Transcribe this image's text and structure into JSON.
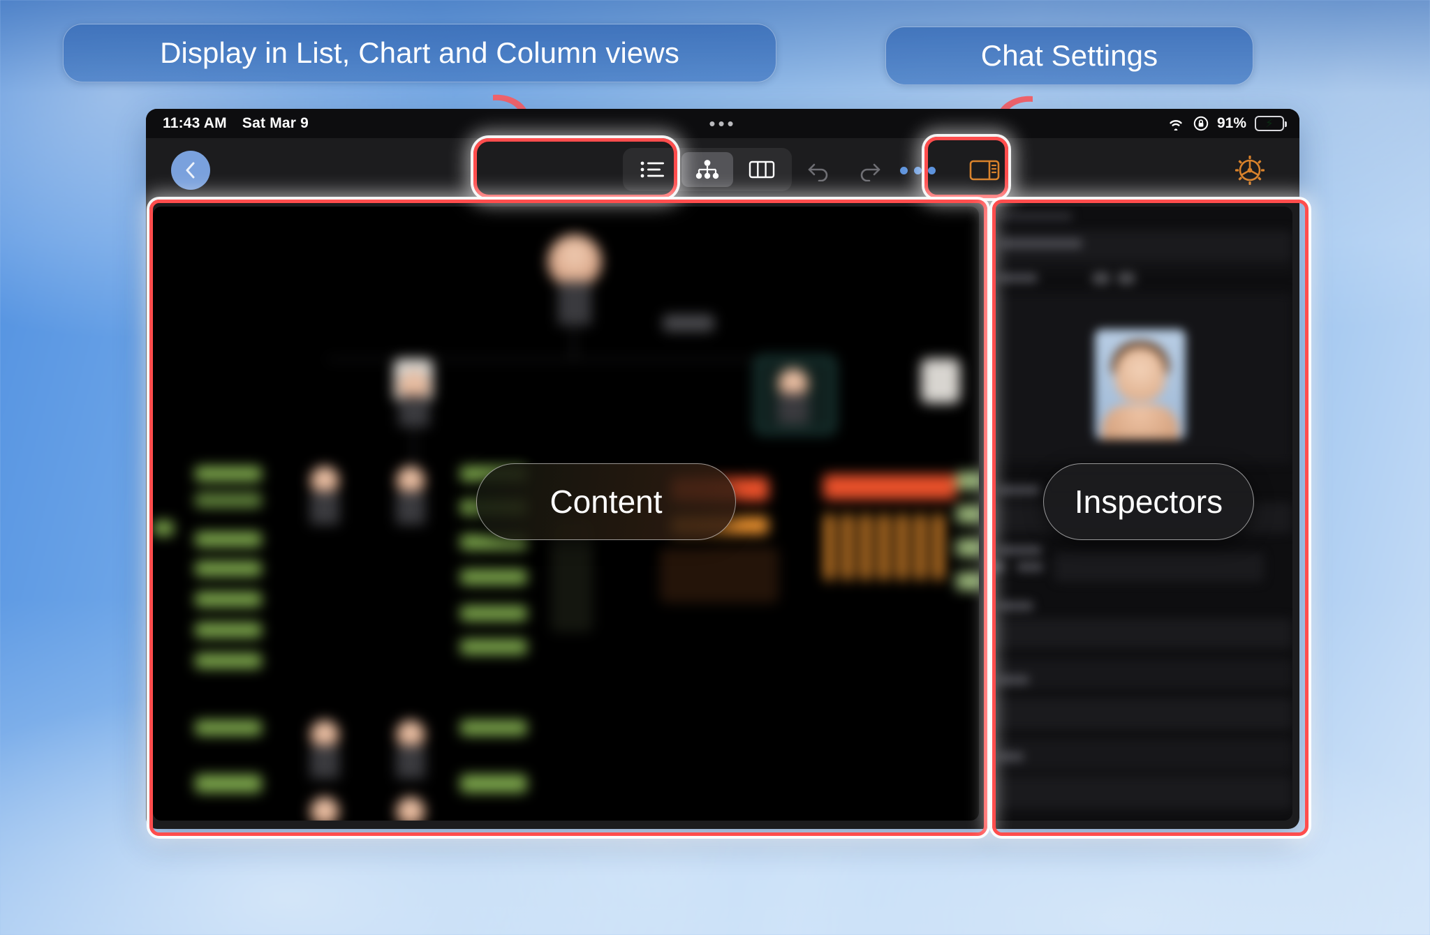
{
  "callouts": {
    "views": "Display in List, Chart and Column views",
    "chat_settings": "Chat Settings"
  },
  "status_bar": {
    "time": "11:43 AM",
    "date": "Sat Mar 9",
    "center_dots": "•••",
    "battery_percent": "91%",
    "wifi_icon": "wifi-icon",
    "rotation_lock_icon": "rotation-lock-icon",
    "battery_icon": "battery-charging-icon"
  },
  "toolbar": {
    "back_icon": "chevron-left-icon",
    "segments": [
      {
        "name": "list-view",
        "icon": "list-bullet-icon",
        "selected": false
      },
      {
        "name": "chart-view",
        "icon": "org-chart-icon",
        "selected": true
      },
      {
        "name": "column-view",
        "icon": "columns-icon",
        "selected": false
      }
    ],
    "undo_icon": "undo-icon",
    "redo_icon": "redo-icon",
    "more_icon": "ellipsis-icon",
    "inspector_toggle_icon": "sidebar-right-icon",
    "settings_icon": "gear-icon"
  },
  "panes": {
    "content_label": "Content",
    "inspector_label": "Inspectors"
  },
  "colors": {
    "accent_blue": "#5d93dd",
    "accent_orange": "#d9822b",
    "highlight_red": "#ff4d4d",
    "battery_green": "#34c759",
    "selected_node_teal": "#2f6f68",
    "card_green": "#7aa34a",
    "card_orange": "#e08a2c",
    "card_red": "#e8502a"
  }
}
